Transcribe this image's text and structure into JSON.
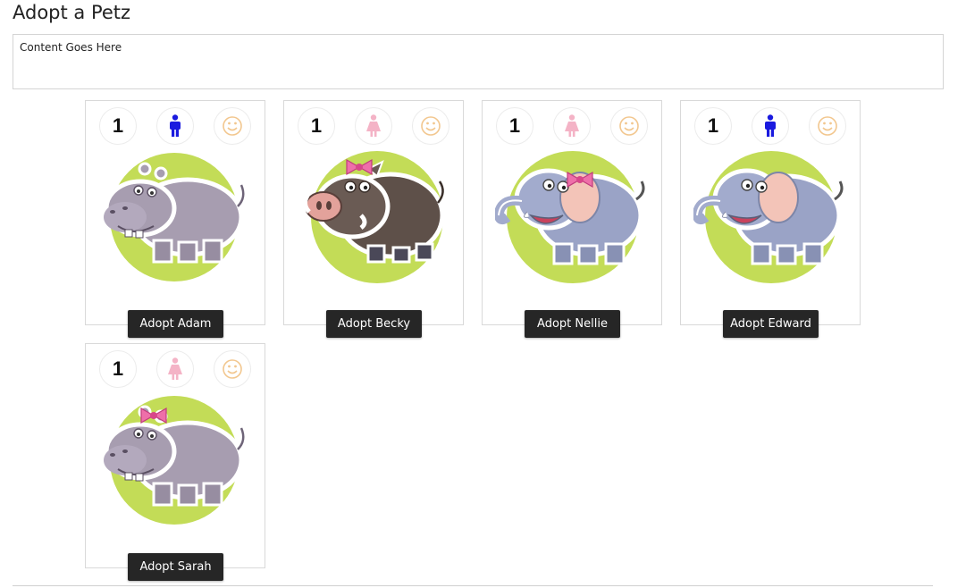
{
  "page": {
    "title": "Adopt a Petz",
    "content_text": "Content Goes Here"
  },
  "colors": {
    "male": "#1a1adf",
    "female": "#f4b3c6",
    "smiley": "#f2c78f",
    "button_bg": "#262626",
    "accent_green": "#c3dc57"
  },
  "pets": [
    {
      "name": "Adam",
      "count": "1",
      "gender": "male",
      "animal": "hippo",
      "bow": false,
      "button_label": "Adopt Adam"
    },
    {
      "name": "Becky",
      "count": "1",
      "gender": "female",
      "animal": "boar",
      "bow": true,
      "button_label": "Adopt Becky"
    },
    {
      "name": "Nellie",
      "count": "1",
      "gender": "female",
      "animal": "elephant",
      "bow": true,
      "button_label": "Adopt Nellie"
    },
    {
      "name": "Edward",
      "count": "1",
      "gender": "male",
      "animal": "elephant",
      "bow": false,
      "button_label": "Adopt Edward"
    },
    {
      "name": "Sarah",
      "count": "1",
      "gender": "female",
      "animal": "hippo",
      "bow": true,
      "button_label": "Adopt Sarah"
    }
  ]
}
